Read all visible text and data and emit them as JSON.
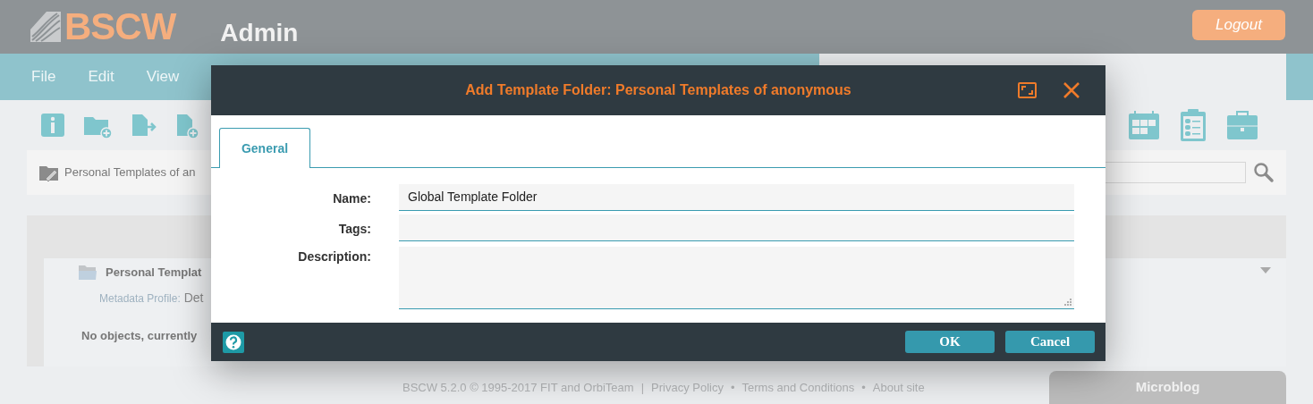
{
  "header": {
    "logo": "BSCW",
    "title": "Admin",
    "logout": "Logout"
  },
  "menu": [
    "File",
    "Edit",
    "View"
  ],
  "breadcrumb": "Personal Templates of an",
  "content": {
    "folder_name": "Personal Templat",
    "metadata_label": "Metadata Profile:",
    "metadata_value": "Det",
    "empty_message": "No objects, currently"
  },
  "footer": {
    "copyright": "BSCW 5.2.0 © 1995-2017 FIT and OrbiTeam",
    "separators": [
      "|",
      "•",
      "•"
    ],
    "links": [
      "Privacy Policy",
      "Terms and Conditions",
      "About site"
    ]
  },
  "microblog": "Microblog",
  "dialog": {
    "title": "Add Template Folder: Personal Templates of anonymous",
    "tabs": [
      {
        "label": "General",
        "selected": true
      }
    ],
    "fields": [
      {
        "kind": "text",
        "label": "Name:",
        "value": "Global Template Folder"
      },
      {
        "kind": "text",
        "label": "Tags:"
      },
      {
        "kind": "textarea",
        "label": "Description:"
      }
    ],
    "buttons": [
      "OK",
      "Cancel"
    ]
  }
}
